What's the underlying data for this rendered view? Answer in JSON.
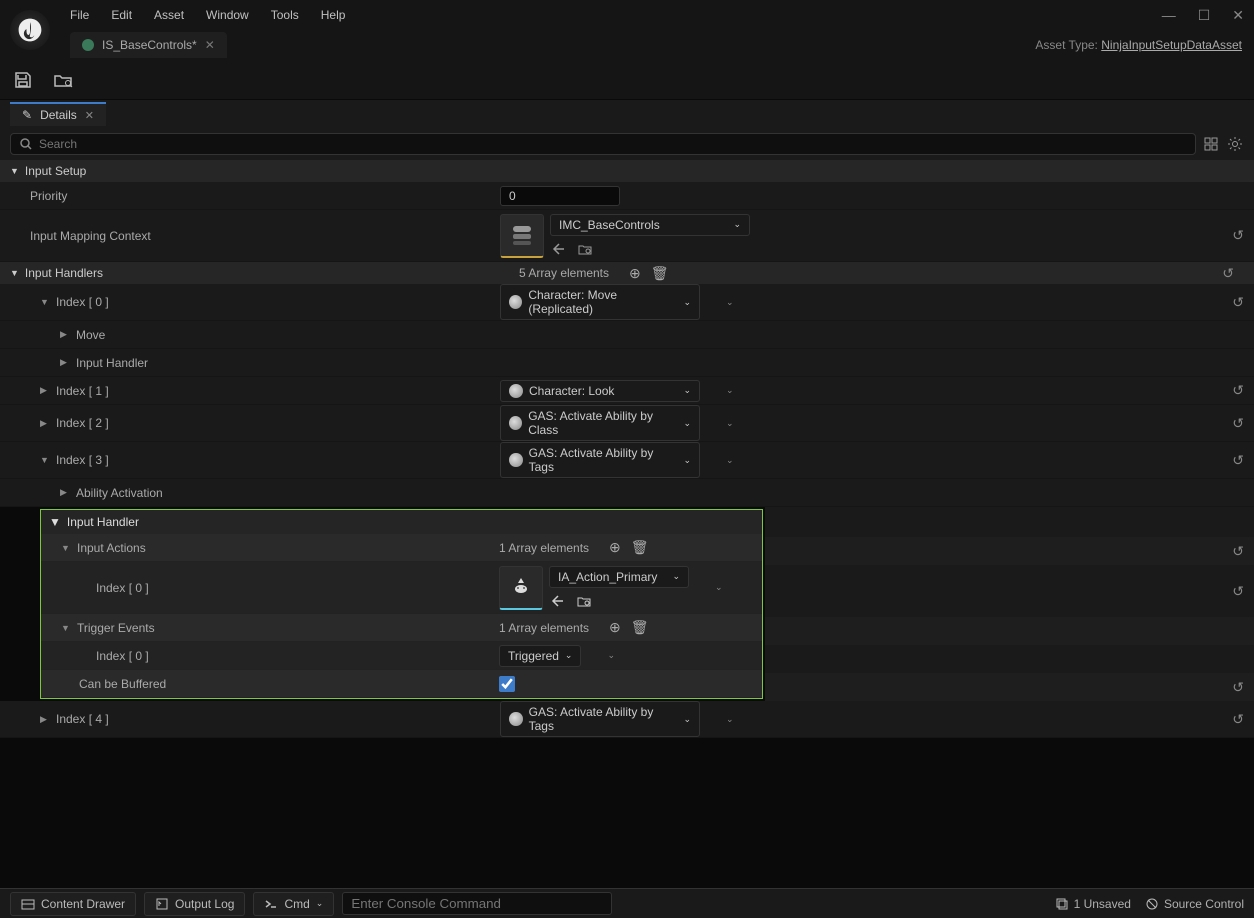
{
  "menu": {
    "file": "File",
    "edit": "Edit",
    "asset": "Asset",
    "window": "Window",
    "tools": "Tools",
    "help": "Help"
  },
  "tab": {
    "name": "IS_BaseControls*"
  },
  "asset_type": {
    "label": "Asset Type:",
    "link": "NinjaInputSetupDataAsset"
  },
  "details": {
    "tab_label": "Details",
    "search_placeholder": "Search"
  },
  "sections": {
    "input_setup": "Input Setup",
    "input_handlers": "Input Handlers"
  },
  "props": {
    "priority_label": "Priority",
    "priority_value": "0",
    "imc_label": "Input Mapping Context",
    "imc_value": "IMC_BaseControls",
    "handlers_count": "5 Array elements",
    "index0": "Index [ 0 ]",
    "index1": "Index [ 1 ]",
    "index2": "Index [ 2 ]",
    "index3": "Index [ 3 ]",
    "index4": "Index [ 4 ]",
    "move": "Move",
    "input_handler": "Input Handler",
    "ability_activation": "Ability Activation",
    "char_move": "Character: Move (Replicated)",
    "char_look": "Character: Look",
    "gas_class": "GAS: Activate Ability by Class",
    "gas_tags": "GAS: Activate Ability by Tags"
  },
  "highlighted": {
    "header": "Input Handler",
    "input_actions": "Input Actions",
    "actions_count": "1 Array elements",
    "index0": "Index [ 0 ]",
    "ia_value": "IA_Action_Primary",
    "trigger_events": "Trigger Events",
    "trigger_count": "1 Array elements",
    "triggered": "Triggered",
    "can_buffered": "Can be Buffered"
  },
  "footer": {
    "content_drawer": "Content Drawer",
    "output_log": "Output Log",
    "cmd": "Cmd",
    "cmd_placeholder": "Enter Console Command",
    "unsaved": "1 Unsaved",
    "source_control": "Source Control"
  }
}
